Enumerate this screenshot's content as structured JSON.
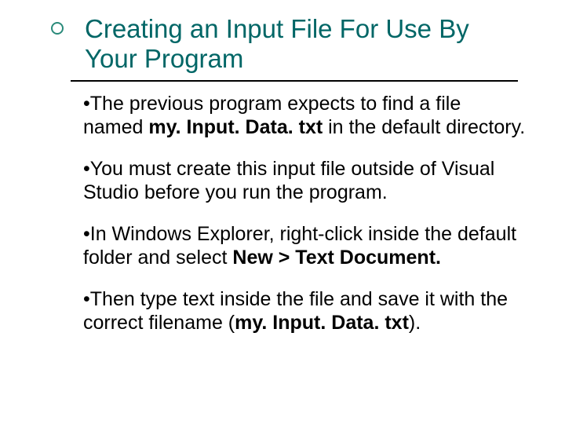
{
  "title": "Creating an Input File For Use By Your Program",
  "bullet_glyph": "•",
  "items": [
    {
      "pre": "The previous program expects to find a file named ",
      "bold": "my. Input. Data. txt",
      "post": " in the default directory."
    },
    {
      "pre": "You must create this input file outside of Visual Studio before you run the program.",
      "bold": "",
      "post": ""
    },
    {
      "pre": "In Windows Explorer, right-click inside the default folder and select ",
      "bold": "New > Text Document.",
      "post": ""
    },
    {
      "pre": "Then type text inside the file and save it with the correct filename (",
      "bold": "my. Input. Data. txt",
      "post": ")."
    }
  ]
}
